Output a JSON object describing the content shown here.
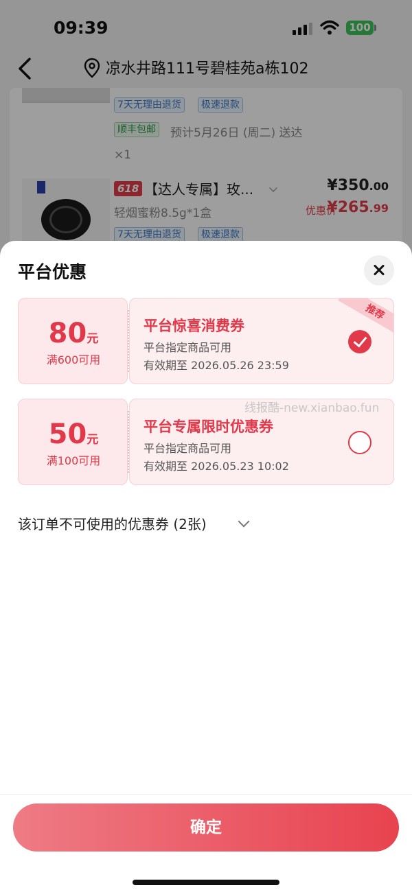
{
  "status_bar": {
    "time": "09:39",
    "battery": "100"
  },
  "header": {
    "address": "凉水井路111号碧桂苑a栋102"
  },
  "order_items": {
    "item1": {
      "tags": [
        "7天无理由退货",
        "极速退款"
      ],
      "shipping_tag": "顺丰包邮",
      "delivery": "预计5月26日 (周二) 送达",
      "quantity": "×1"
    },
    "item2": {
      "badge": "618",
      "title": "【达人专属】玫...",
      "spec": "轻烟蜜粉8.5g*1盒",
      "price_int": "¥350",
      "price_dec": ".00",
      "promo_label": "优惠价",
      "promo_int": "¥265",
      "promo_dec": ".99",
      "tags": [
        "7天无理由退货",
        "极速退款"
      ]
    }
  },
  "sheet": {
    "title": "平台优惠",
    "coupons": [
      {
        "amount": "80",
        "unit": "元",
        "condition": "满600可用",
        "name": "平台惊喜消费券",
        "scope": "平台指定商品可用",
        "valid": "有效期至 2026.05.26 23:59",
        "selected": true,
        "ribbon": "推荐"
      },
      {
        "amount": "50",
        "unit": "元",
        "condition": "满100可用",
        "name": "平台专属限时优惠券",
        "scope": "平台指定商品可用",
        "valid": "有效期至 2026.05.23 10:02",
        "selected": false
      }
    ],
    "unusable_text": "该订单不可使用的优惠券 (2张)",
    "confirm_label": "确定"
  },
  "watermark": "线报酷-new.xianbao.fun",
  "colors": {
    "accent": "#e1394a",
    "coupon_bg": "#fdeef0",
    "battery": "#3dc25a"
  }
}
